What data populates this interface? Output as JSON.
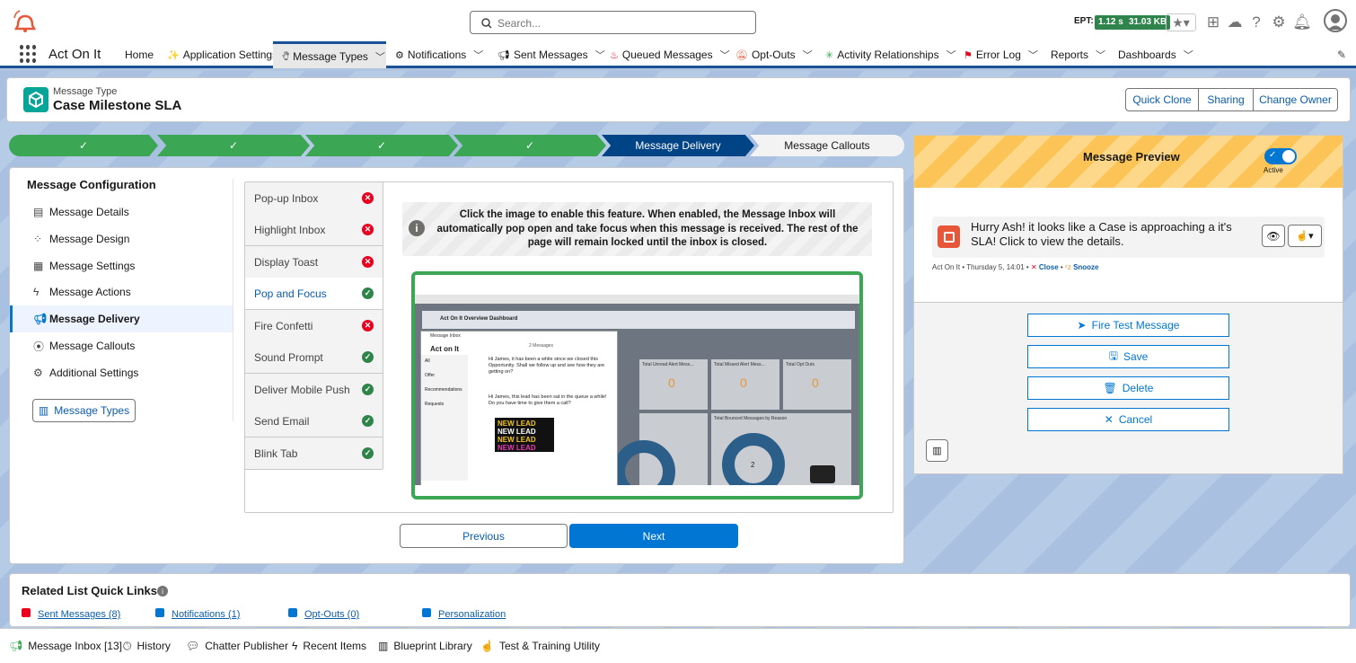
{
  "header": {
    "search_placeholder": "Search...",
    "ept_label": "EPT:",
    "ept_time": "1.12 s",
    "ept_size": "31.03 KB"
  },
  "nav": {
    "app_name": "Act On It",
    "items": [
      {
        "label": "Home"
      },
      {
        "label": "Application Settings"
      },
      {
        "label": "Message Types"
      },
      {
        "label": "Notifications"
      },
      {
        "label": "Sent Messages"
      },
      {
        "label": "Queued Messages"
      },
      {
        "label": "Opt-Outs"
      },
      {
        "label": "Activity Relationships"
      },
      {
        "label": "Error Log"
      },
      {
        "label": "Reports"
      },
      {
        "label": "Dashboards"
      }
    ]
  },
  "record": {
    "type_label": "Message Type",
    "name": "Case Milestone SLA",
    "actions": [
      "Quick Clone",
      "Sharing",
      "Change Owner"
    ]
  },
  "path": {
    "steps": [
      "",
      "",
      "",
      "",
      "Message Delivery",
      "Message Callouts"
    ],
    "completed": 4,
    "current": "Message Delivery"
  },
  "config": {
    "title": "Message Configuration",
    "menu": [
      {
        "label": "Message Details",
        "icon": "details-icon"
      },
      {
        "label": "Message Design",
        "icon": "design-icon"
      },
      {
        "label": "Message Settings",
        "icon": "settings-icon"
      },
      {
        "label": "Message Actions",
        "icon": "bolt-icon"
      },
      {
        "label": "Message Delivery",
        "icon": "delivery-icon"
      },
      {
        "label": "Message Callouts",
        "icon": "callout-icon"
      },
      {
        "label": "Additional Settings",
        "icon": "gear-icon"
      }
    ],
    "types_button": "Message Types",
    "features": [
      {
        "label": "Pop-up Inbox",
        "enabled": false
      },
      {
        "label": "Highlight Inbox",
        "enabled": false
      },
      {
        "label": "Display Toast",
        "enabled": false
      },
      {
        "label": "Pop and Focus",
        "enabled": true
      },
      {
        "label": "Fire Confetti",
        "enabled": false
      },
      {
        "label": "Sound Prompt",
        "enabled": true
      },
      {
        "label": "Deliver Mobile Push",
        "enabled": true
      },
      {
        "label": "Send Email",
        "enabled": true
      },
      {
        "label": "Blink Tab",
        "enabled": true
      }
    ],
    "info_text": "Click the image to enable this feature. When enabled, the Message Inbox will automatically pop open and take focus when this message is received. The rest of the page will remain locked until the inbox is closed.",
    "prev_button": "Previous",
    "next_button": "Next"
  },
  "embedded_shot": {
    "app": "Act on It",
    "dashboard_title": "Act On It Overview Dashboard",
    "inbox_header": "Message Inbox",
    "messages_count": "2 Messages",
    "inbox_tabs": [
      "All",
      "Offer",
      "Recommendations",
      "Requests"
    ],
    "msg1": "Hi James, it has been a while since we closed this Opportunity. Shall we follow up and see how they are getting on?",
    "msg2": "Hi James, this lead has been sat in the queue a while! Do you have time to give them a call?",
    "lead_text": "NEW LEAD",
    "tiles": [
      {
        "title": "Total Unread Alert Mess...",
        "value": "0"
      },
      {
        "title": "Total Missed Alert Mess...",
        "value": "0"
      },
      {
        "title": "Total Opt Outs",
        "value": "0"
      }
    ],
    "donut_title": "Total Bounced Messages by Reason",
    "donut_value": "2"
  },
  "preview": {
    "title": "Message Preview",
    "toggle_label": "Active",
    "message": "Hurry Ash! it looks like a Case is approaching a it's SLA! Click to view the details.",
    "meta_source": "Act On It • Thursday 5, 14:01 •",
    "close_label": "Close",
    "snooze_label": "Snooze",
    "buttons": [
      "Fire Test Message",
      "Save",
      "Delete",
      "Cancel"
    ]
  },
  "related": {
    "title": "Related List Quick Links",
    "links": [
      "Sent Messages (8)",
      "Notifications (1)",
      "Opt-Outs (0)",
      "Personalization"
    ]
  },
  "footer": {
    "items": [
      "Message Inbox [13]",
      "History",
      "Chatter Publisher",
      "Recent Items",
      "Blueprint Library",
      "Test & Training Utility"
    ]
  },
  "colors": {
    "brand": "#0176d3",
    "success": "#3ba755",
    "error": "#ea001e",
    "nav_accent": "#1b5297"
  }
}
